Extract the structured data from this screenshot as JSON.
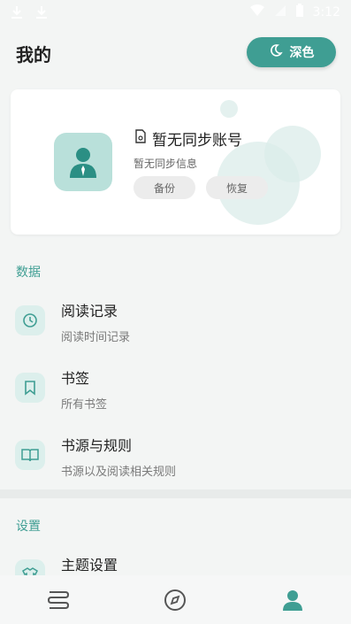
{
  "status_bar": {
    "time": "3:12"
  },
  "header": {
    "title": "我的",
    "theme_button": "深色"
  },
  "account": {
    "name": "暂无同步账号",
    "subtitle": "暂无同步信息",
    "backup_label": "备份",
    "restore_label": "恢复"
  },
  "sections": {
    "data": "数据",
    "settings": "设置"
  },
  "data_items": [
    {
      "title": "阅读记录",
      "subtitle": "阅读时间记录"
    },
    {
      "title": "书签",
      "subtitle": "所有书签"
    },
    {
      "title": "书源与规则",
      "subtitle": "书源以及阅读相关规则"
    }
  ],
  "settings_items": [
    {
      "title": "主题设置"
    }
  ],
  "colors": {
    "accent": "#3f9e93",
    "accent_light": "#dcefec",
    "background": "#f3f5f4"
  }
}
